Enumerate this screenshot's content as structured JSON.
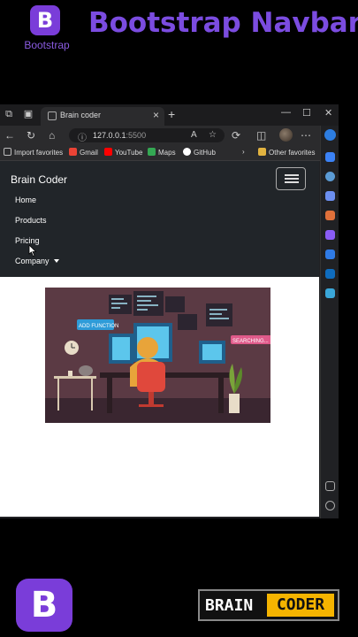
{
  "header": {
    "logo_letter": "B",
    "logo_label": "Bootstrap",
    "title": "Bootstrap Navbar"
  },
  "browser": {
    "tab": {
      "title": "Brain coder"
    },
    "address": {
      "host": "127.0.0.1",
      "port": ":5500"
    },
    "favorites": [
      {
        "label": "Import favorites",
        "icon": "import-icon"
      },
      {
        "label": "Gmail",
        "icon": "gmail-icon"
      },
      {
        "label": "YouTube",
        "icon": "youtube-icon"
      },
      {
        "label": "Maps",
        "icon": "maps-icon"
      },
      {
        "label": "GitHub",
        "icon": "github-icon"
      }
    ],
    "other_favorites": "Other favorites"
  },
  "navbar": {
    "brand": "Brain Coder",
    "links": [
      {
        "label": "Home"
      },
      {
        "label": "Products"
      },
      {
        "label": "Pricing"
      },
      {
        "label": "Company"
      }
    ]
  },
  "illustration": {
    "label_add": "ADD FUNCTION",
    "label_search": "SEARCHING..."
  },
  "footer": {
    "logo_letter": "B",
    "badge_left": "BRAIN",
    "badge_right": "CODER"
  },
  "colors": {
    "accent": "#7b4ce0",
    "navbar_bg": "#212529",
    "badge_yellow": "#f5b400"
  }
}
